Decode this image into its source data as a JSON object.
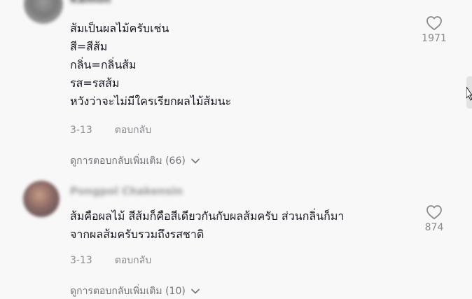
{
  "comments": [
    {
      "username": "Kamon",
      "text": "ส้มเป็นผลไม้ครับเช่น\nสี=สีส้ม\nกลิ่น=กลิ่นส้ม\nรส=รสส้ม\nหวังว่าจะไม่มีใครเรียกผลไม้ส้มนะ",
      "date": "3-13",
      "reply_label": "ตอบกลับ",
      "likes": "1971",
      "view_replies": "ดูการตอบกลับเพิ่มเติม (66)"
    },
    {
      "username": "Pongpol Chakensin",
      "text": "ส้มคือผลไม้ สีส้มก็คือสีเดียวกันกับผลส้มครับ ส่วนกลิ่นก็มา\nจากผลส้มครับรวมถึงรสชาติ",
      "date": "3-13",
      "reply_label": "ตอบกลับ",
      "likes": "874",
      "view_replies": "ดูการตอบกลับเพิ่มเติม (10)"
    }
  ],
  "icons": {
    "like": "heart-outline-icon",
    "expand": "chevron-down-icon"
  },
  "colors": {
    "background": "#f8f8f8",
    "text": "#161823",
    "muted": "#8a8b91"
  }
}
